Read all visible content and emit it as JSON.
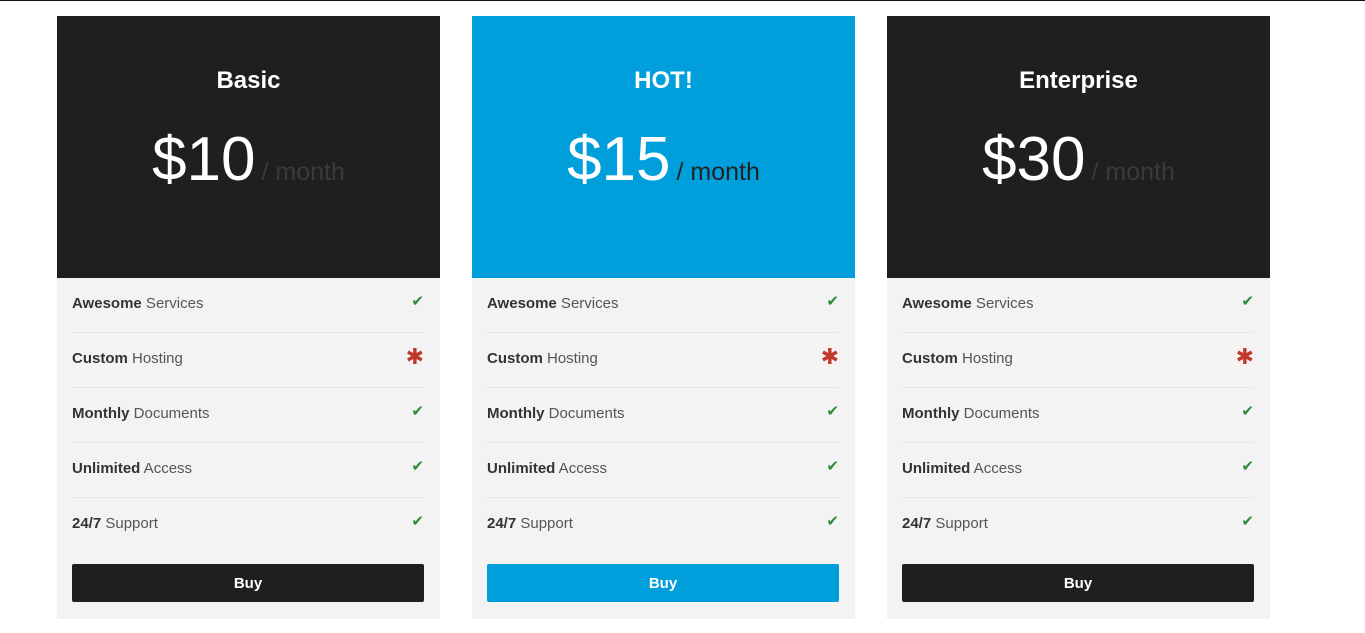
{
  "plans": [
    {
      "title": "Basic",
      "price": "$10",
      "period": "/ month",
      "features": [
        {
          "strong": "Awesome",
          "text": " Services",
          "icon": "check-icon"
        },
        {
          "strong": "Custom",
          "text": " Hosting",
          "icon": "asterisk-icon"
        },
        {
          "strong": "Monthly",
          "text": " Documents",
          "icon": "check-icon"
        },
        {
          "strong": "Unlimited",
          "text": " Access",
          "icon": "check-icon"
        },
        {
          "strong": "24/7",
          "text": " Support",
          "icon": "check-icon"
        }
      ],
      "button_label": "Buy",
      "accent": "#1f1f1f"
    },
    {
      "title": "HOT!",
      "price": "$15",
      "period": "/ month",
      "features": [
        {
          "strong": "Awesome",
          "text": " Services",
          "icon": "check-icon"
        },
        {
          "strong": "Custom",
          "text": " Hosting",
          "icon": "asterisk-icon"
        },
        {
          "strong": "Monthly",
          "text": " Documents",
          "icon": "check-icon"
        },
        {
          "strong": "Unlimited",
          "text": " Access",
          "icon": "check-icon"
        },
        {
          "strong": "24/7",
          "text": " Support",
          "icon": "check-icon"
        }
      ],
      "button_label": "Buy",
      "accent": "#009fdc"
    },
    {
      "title": "Enterprise",
      "price": "$30",
      "period": "/ month",
      "features": [
        {
          "strong": "Awesome",
          "text": " Services",
          "icon": "check-icon"
        },
        {
          "strong": "Custom",
          "text": " Hosting",
          "icon": "asterisk-icon"
        },
        {
          "strong": "Monthly",
          "text": " Documents",
          "icon": "check-icon"
        },
        {
          "strong": "Unlimited",
          "text": " Access",
          "icon": "check-icon"
        },
        {
          "strong": "24/7",
          "text": " Support",
          "icon": "check-icon"
        }
      ],
      "button_label": "Buy",
      "accent": "#1f1f1f"
    }
  ],
  "colors": {
    "check": "#2e8b3e",
    "asterisk": "#c0392b",
    "card_body": "#f3f3f3"
  }
}
